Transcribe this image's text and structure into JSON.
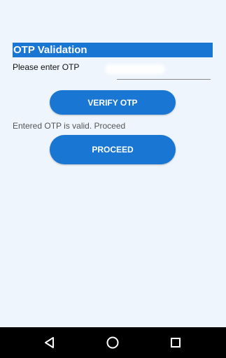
{
  "header": {
    "title": "OTP Validation"
  },
  "form": {
    "prompt_label": "Please enter OTP",
    "otp_value": "",
    "verify_label": "VERIFY OTP",
    "status_message": "Entered OTP is valid. Proceed",
    "proceed_label": "PROCEED"
  },
  "navbar": {
    "back_icon": "back-triangle-icon",
    "home_icon": "home-circle-icon",
    "recent_icon": "recent-apps-square-icon"
  },
  "colors": {
    "accent": "#1976d2",
    "background": "#eef5fd",
    "navbar": "#000000"
  }
}
